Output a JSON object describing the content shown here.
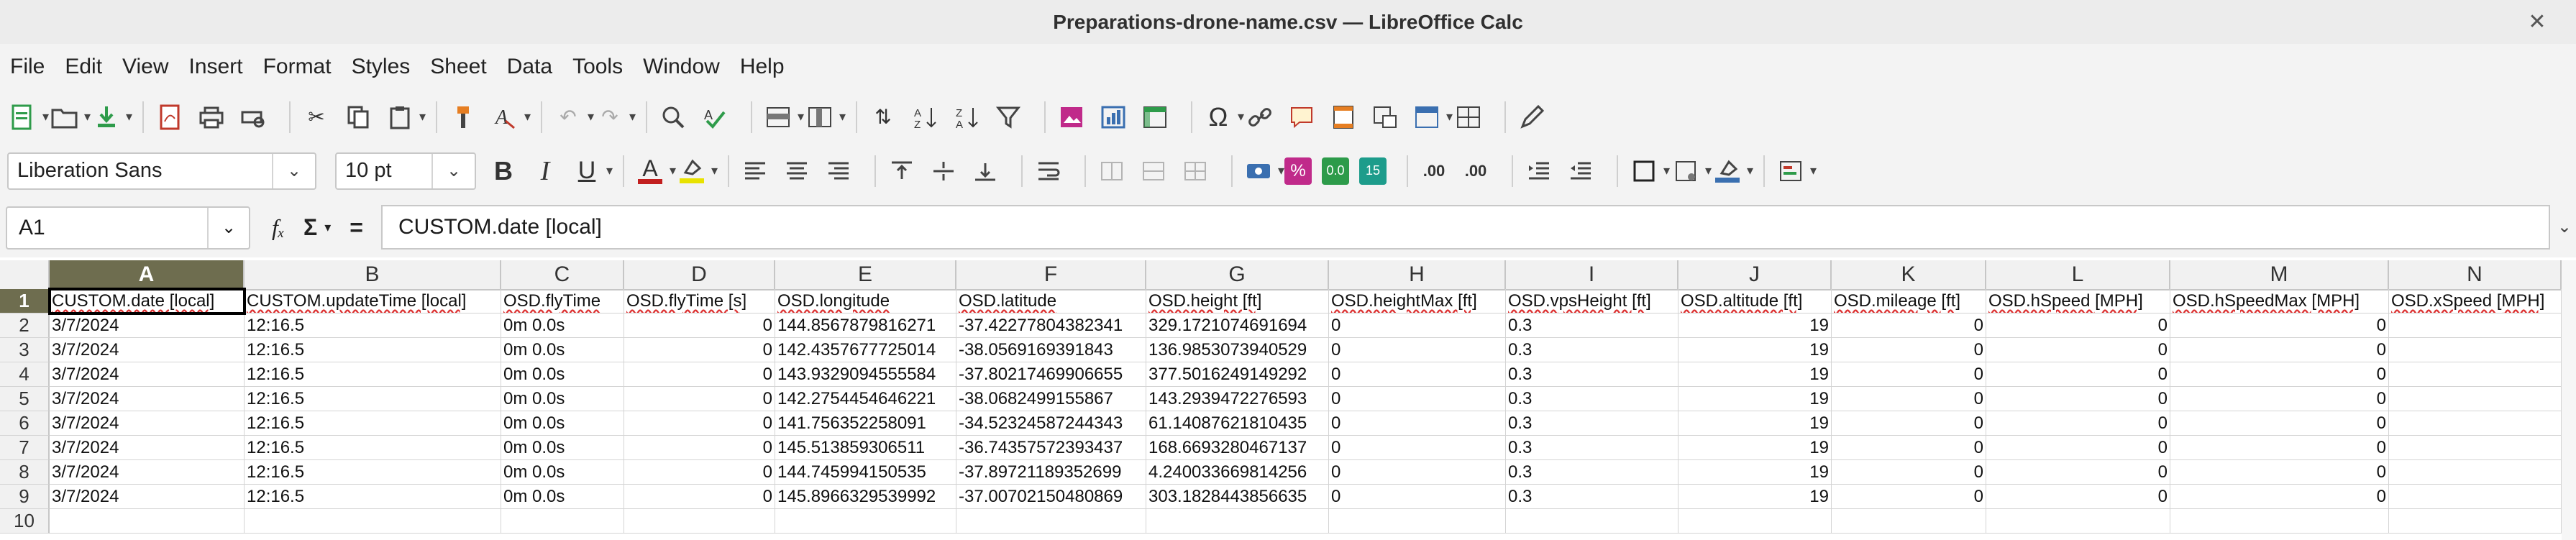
{
  "window": {
    "title": "Preparations-drone-name.csv — LibreOffice Calc",
    "close_glyph": "✕"
  },
  "menu": [
    "File",
    "Edit",
    "View",
    "Insert",
    "Format",
    "Styles",
    "Sheet",
    "Data",
    "Tools",
    "Window",
    "Help"
  ],
  "toolbar": {
    "font_name": "Liberation Sans",
    "font_size": "10 pt",
    "bold": "B",
    "italic": "I",
    "underline": "U",
    "font_color_letter": "A",
    "number_format_percent": "%",
    "number_format_decimal": "0.0",
    "number_format_date": "15",
    "add_decimal": ".00",
    "del_decimal": ".00",
    "accent_colors": {
      "new_doc": "#2e9b4a",
      "pdf": "#c0392b",
      "font_color": "#c21f1f",
      "highlight": "#e8e200",
      "image": "#c02a8a",
      "number_green": "#2d9b4a",
      "teal": "#1d9c8b"
    }
  },
  "formula_bar": {
    "name_box": "A1",
    "fx": "fₓ",
    "sigma": "Σ",
    "equals": "=",
    "content": "CUSTOM.date [local]"
  },
  "sheet": {
    "selected_column": "A",
    "selected_row": "1",
    "columns": [
      "A",
      "B",
      "C",
      "D",
      "E",
      "F",
      "G",
      "H",
      "I",
      "J",
      "K",
      "L",
      "M",
      "N"
    ],
    "rows": [
      "1",
      "2",
      "3",
      "4",
      "5",
      "6",
      "7",
      "8",
      "9",
      "10"
    ],
    "headers": [
      "CUSTOM.date [local]",
      "CUSTOM.updateTime [local]",
      "OSD.flyTime",
      "OSD.flyTime [s]",
      "OSD.longitude",
      "OSD.latitude",
      "OSD.height [ft]",
      "OSD.heightMax [ft]",
      "OSD.vpsHeight [ft]",
      "OSD.altitude [ft]",
      "OSD.mileage [ft]",
      "OSD.hSpeed [MPH]",
      "OSD.hSpeedMax [MPH]",
      "OSD.xSpeed [MPH]"
    ],
    "data": [
      [
        "3/7/2024",
        "12:16.5",
        "0m 0.0s",
        "0",
        "144.8567879816271",
        "-37.42277804382341",
        "329.1721074691694",
        "0",
        "0.3",
        "19",
        "0",
        "0",
        "0",
        ""
      ],
      [
        "3/7/2024",
        "12:16.5",
        "0m 0.0s",
        "0",
        "142.4357677725014",
        "-38.0569169391843",
        "136.9853073940529",
        "0",
        "0.3",
        "19",
        "0",
        "0",
        "0",
        ""
      ],
      [
        "3/7/2024",
        "12:16.5",
        "0m 0.0s",
        "0",
        "143.9329094555584",
        "-37.80217469906655",
        "377.5016249149292",
        "0",
        "0.3",
        "19",
        "0",
        "0",
        "0",
        ""
      ],
      [
        "3/7/2024",
        "12:16.5",
        "0m 0.0s",
        "0",
        "142.2754454646221",
        "-38.0682499155867",
        "143.2939472276593",
        "0",
        "0.3",
        "19",
        "0",
        "0",
        "0",
        ""
      ],
      [
        "3/7/2024",
        "12:16.5",
        "0m 0.0s",
        "0",
        "141.756352258091",
        "-34.52324587244343",
        "61.14087621810435",
        "0",
        "0.3",
        "19",
        "0",
        "0",
        "0",
        ""
      ],
      [
        "3/7/2024",
        "12:16.5",
        "0m 0.0s",
        "0",
        "145.513859306511",
        "-36.74357572393437",
        "168.6693280467137",
        "0",
        "0.3",
        "19",
        "0",
        "0",
        "0",
        ""
      ],
      [
        "3/7/2024",
        "12:16.5",
        "0m 0.0s",
        "0",
        "144.745994150535",
        "-37.89721189352699",
        "4.240033669814256",
        "0",
        "0.3",
        "19",
        "0",
        "0",
        "0",
        ""
      ],
      [
        "3/7/2024",
        "12:16.5",
        "0m 0.0s",
        "0",
        "145.8966329539992",
        "-37.00702150480869",
        "303.1828443856635",
        "0",
        "0.3",
        "19",
        "0",
        "0",
        "0",
        ""
      ],
      [
        "",
        "",
        "",
        "",
        "",
        "",
        "",
        "",
        "",
        "",
        "",
        "",
        "",
        ""
      ]
    ]
  }
}
